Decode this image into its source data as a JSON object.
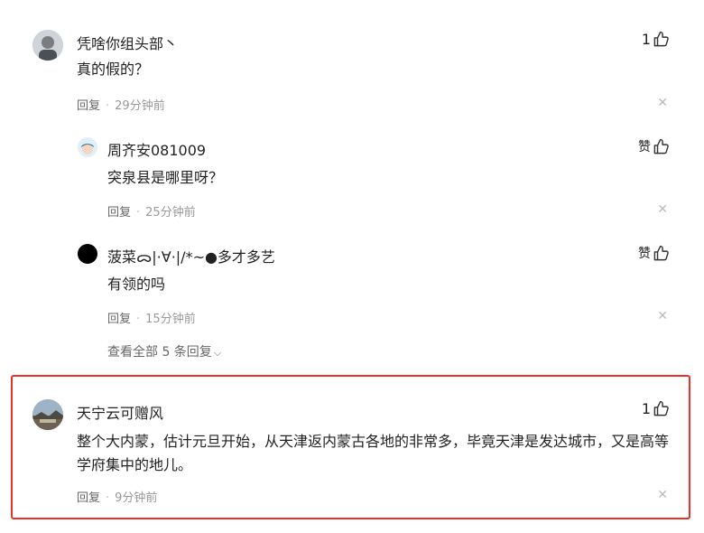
{
  "comments": [
    {
      "name": "凭啥你组头部丶",
      "text": "真的假的？",
      "like": "1",
      "reply_label": "回复",
      "time": "29分钟前",
      "replies": [
        {
          "name": "周齐安081009",
          "text": "突泉县是哪里呀？",
          "like": "赞",
          "reply_label": "回复",
          "time": "25分钟前"
        },
        {
          "name": "菠菜ᯅ|·∀·|/*~●多才多艺",
          "text": "有领的吗",
          "like": "赞",
          "reply_label": "回复",
          "time": "15分钟前"
        }
      ],
      "view_all": "查看全部 5 条回复"
    },
    {
      "name": "天宁云可赠风",
      "text": "整个大内蒙，估计元旦开始，从天津返内蒙古各地的非常多，毕竟天津是发达城市，又是高等学府集中的地儿。",
      "like": "1",
      "reply_label": "回复",
      "time": "9分钟前"
    }
  ],
  "icons": {
    "like": "thumbs-up-icon",
    "close": "close-icon",
    "chevron": "chevron-down-icon"
  },
  "colors": {
    "highlight": "#e8322a",
    "meta": "#999999"
  }
}
